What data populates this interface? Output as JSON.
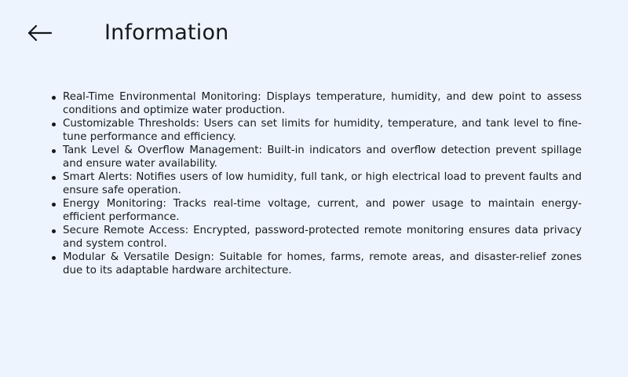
{
  "header": {
    "back_icon": "arrow-left-icon",
    "title": "Information"
  },
  "features": [
    "Real-Time Environmental Monitoring: Displays temperature, humidity, and dew point to assess conditions and optimize water production.",
    "Customizable Thresholds: Users can set limits for humidity, temperature, and tank level to fine-tune performance and efficiency.",
    "Tank Level & Overflow Management: Built-in indicators and overflow detection prevent spillage and ensure water availability.",
    "Smart Alerts: Notifies users of low humidity, full tank, or high electrical load to prevent faults and ensure safe operation.",
    "Energy Monitoring: Tracks real-time voltage, current, and power usage to maintain energy-efficient performance.",
    "Secure Remote Access: Encrypted, password-protected remote monitoring ensures data privacy and system control.",
    "Modular & Versatile Design: Suitable for homes, farms, remote areas, and disaster-relief zones due to its adaptable hardware architecture."
  ]
}
